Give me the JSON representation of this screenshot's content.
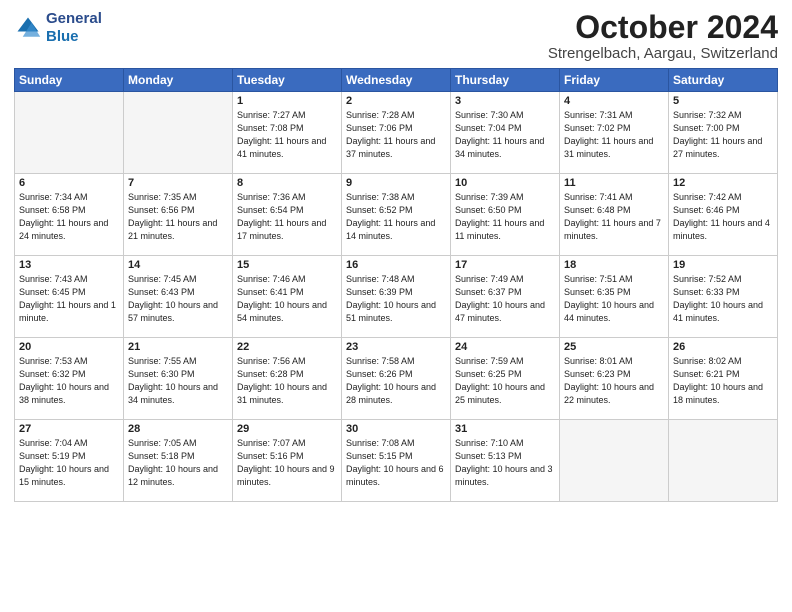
{
  "header": {
    "logo_line1": "General",
    "logo_line2": "Blue",
    "month": "October 2024",
    "location": "Strengelbach, Aargau, Switzerland"
  },
  "weekdays": [
    "Sunday",
    "Monday",
    "Tuesday",
    "Wednesday",
    "Thursday",
    "Friday",
    "Saturday"
  ],
  "weeks": [
    [
      {
        "day": "",
        "detail": ""
      },
      {
        "day": "",
        "detail": ""
      },
      {
        "day": "1",
        "detail": "Sunrise: 7:27 AM\nSunset: 7:08 PM\nDaylight: 11 hours and 41 minutes."
      },
      {
        "day": "2",
        "detail": "Sunrise: 7:28 AM\nSunset: 7:06 PM\nDaylight: 11 hours and 37 minutes."
      },
      {
        "day": "3",
        "detail": "Sunrise: 7:30 AM\nSunset: 7:04 PM\nDaylight: 11 hours and 34 minutes."
      },
      {
        "day": "4",
        "detail": "Sunrise: 7:31 AM\nSunset: 7:02 PM\nDaylight: 11 hours and 31 minutes."
      },
      {
        "day": "5",
        "detail": "Sunrise: 7:32 AM\nSunset: 7:00 PM\nDaylight: 11 hours and 27 minutes."
      }
    ],
    [
      {
        "day": "6",
        "detail": "Sunrise: 7:34 AM\nSunset: 6:58 PM\nDaylight: 11 hours and 24 minutes."
      },
      {
        "day": "7",
        "detail": "Sunrise: 7:35 AM\nSunset: 6:56 PM\nDaylight: 11 hours and 21 minutes."
      },
      {
        "day": "8",
        "detail": "Sunrise: 7:36 AM\nSunset: 6:54 PM\nDaylight: 11 hours and 17 minutes."
      },
      {
        "day": "9",
        "detail": "Sunrise: 7:38 AM\nSunset: 6:52 PM\nDaylight: 11 hours and 14 minutes."
      },
      {
        "day": "10",
        "detail": "Sunrise: 7:39 AM\nSunset: 6:50 PM\nDaylight: 11 hours and 11 minutes."
      },
      {
        "day": "11",
        "detail": "Sunrise: 7:41 AM\nSunset: 6:48 PM\nDaylight: 11 hours and 7 minutes."
      },
      {
        "day": "12",
        "detail": "Sunrise: 7:42 AM\nSunset: 6:46 PM\nDaylight: 11 hours and 4 minutes."
      }
    ],
    [
      {
        "day": "13",
        "detail": "Sunrise: 7:43 AM\nSunset: 6:45 PM\nDaylight: 11 hours and 1 minute."
      },
      {
        "day": "14",
        "detail": "Sunrise: 7:45 AM\nSunset: 6:43 PM\nDaylight: 10 hours and 57 minutes."
      },
      {
        "day": "15",
        "detail": "Sunrise: 7:46 AM\nSunset: 6:41 PM\nDaylight: 10 hours and 54 minutes."
      },
      {
        "day": "16",
        "detail": "Sunrise: 7:48 AM\nSunset: 6:39 PM\nDaylight: 10 hours and 51 minutes."
      },
      {
        "day": "17",
        "detail": "Sunrise: 7:49 AM\nSunset: 6:37 PM\nDaylight: 10 hours and 47 minutes."
      },
      {
        "day": "18",
        "detail": "Sunrise: 7:51 AM\nSunset: 6:35 PM\nDaylight: 10 hours and 44 minutes."
      },
      {
        "day": "19",
        "detail": "Sunrise: 7:52 AM\nSunset: 6:33 PM\nDaylight: 10 hours and 41 minutes."
      }
    ],
    [
      {
        "day": "20",
        "detail": "Sunrise: 7:53 AM\nSunset: 6:32 PM\nDaylight: 10 hours and 38 minutes."
      },
      {
        "day": "21",
        "detail": "Sunrise: 7:55 AM\nSunset: 6:30 PM\nDaylight: 10 hours and 34 minutes."
      },
      {
        "day": "22",
        "detail": "Sunrise: 7:56 AM\nSunset: 6:28 PM\nDaylight: 10 hours and 31 minutes."
      },
      {
        "day": "23",
        "detail": "Sunrise: 7:58 AM\nSunset: 6:26 PM\nDaylight: 10 hours and 28 minutes."
      },
      {
        "day": "24",
        "detail": "Sunrise: 7:59 AM\nSunset: 6:25 PM\nDaylight: 10 hours and 25 minutes."
      },
      {
        "day": "25",
        "detail": "Sunrise: 8:01 AM\nSunset: 6:23 PM\nDaylight: 10 hours and 22 minutes."
      },
      {
        "day": "26",
        "detail": "Sunrise: 8:02 AM\nSunset: 6:21 PM\nDaylight: 10 hours and 18 minutes."
      }
    ],
    [
      {
        "day": "27",
        "detail": "Sunrise: 7:04 AM\nSunset: 5:19 PM\nDaylight: 10 hours and 15 minutes."
      },
      {
        "day": "28",
        "detail": "Sunrise: 7:05 AM\nSunset: 5:18 PM\nDaylight: 10 hours and 12 minutes."
      },
      {
        "day": "29",
        "detail": "Sunrise: 7:07 AM\nSunset: 5:16 PM\nDaylight: 10 hours and 9 minutes."
      },
      {
        "day": "30",
        "detail": "Sunrise: 7:08 AM\nSunset: 5:15 PM\nDaylight: 10 hours and 6 minutes."
      },
      {
        "day": "31",
        "detail": "Sunrise: 7:10 AM\nSunset: 5:13 PM\nDaylight: 10 hours and 3 minutes."
      },
      {
        "day": "",
        "detail": ""
      },
      {
        "day": "",
        "detail": ""
      }
    ]
  ]
}
